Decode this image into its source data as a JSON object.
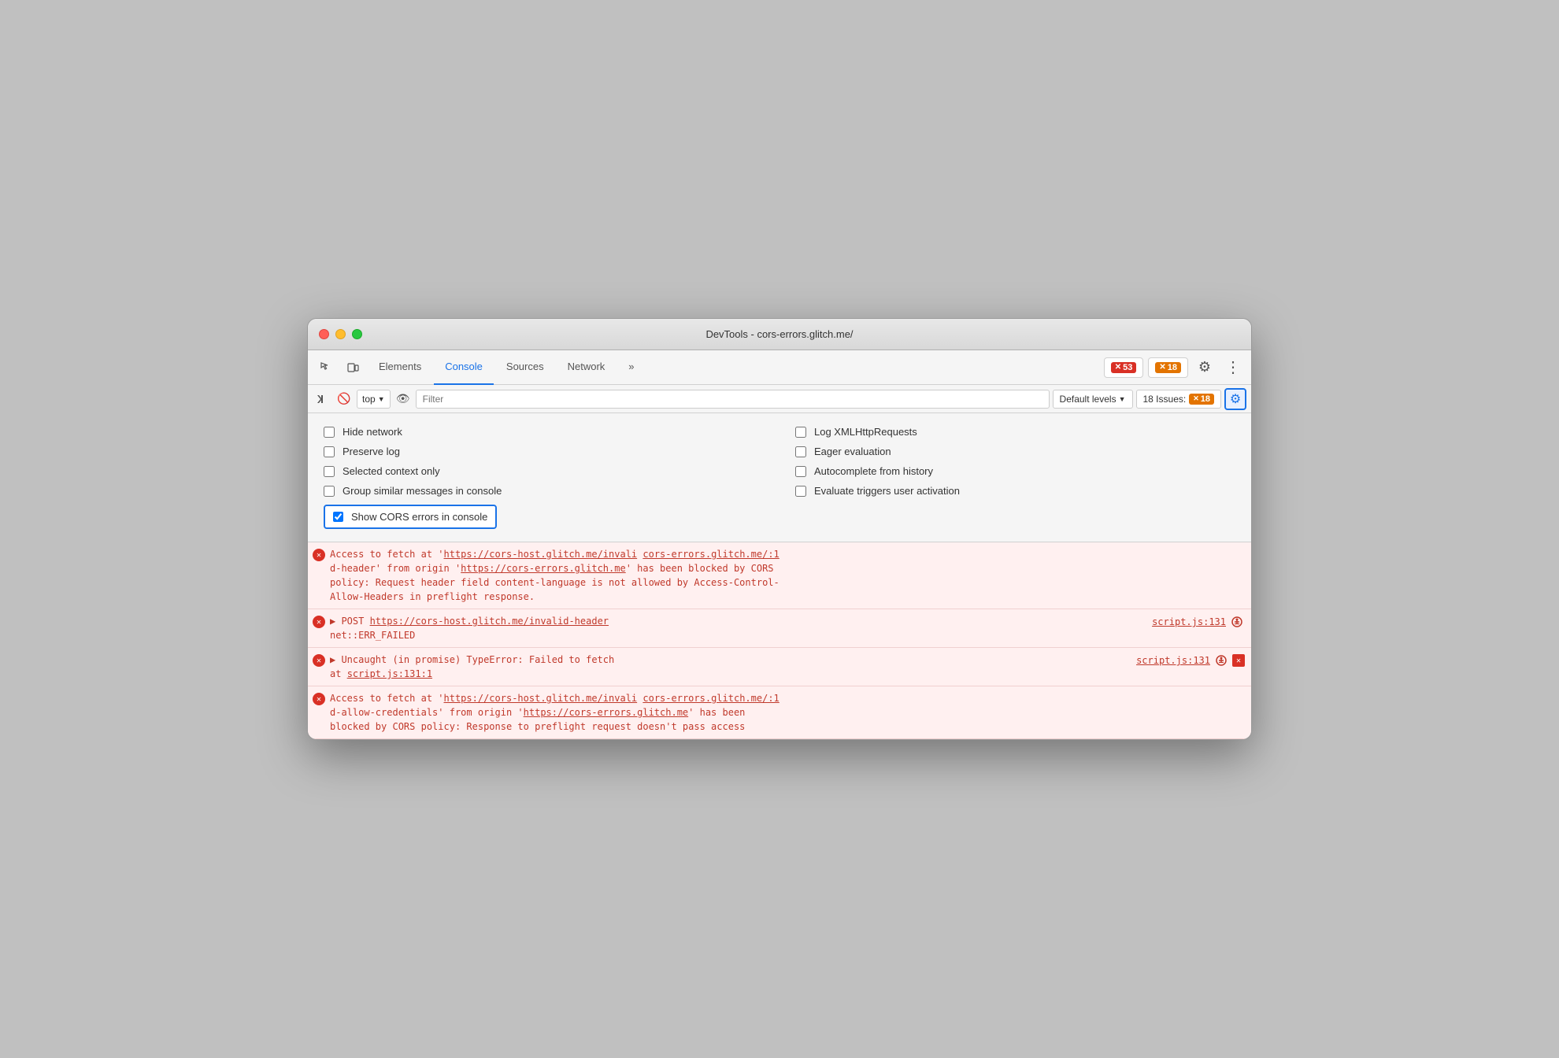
{
  "window": {
    "title": "DevTools - cors-errors.glitch.me/"
  },
  "toolbar": {
    "tabs": [
      {
        "label": "Elements",
        "active": false
      },
      {
        "label": "Console",
        "active": true
      },
      {
        "label": "Sources",
        "active": false
      },
      {
        "label": "Network",
        "active": false
      },
      {
        "label": "»",
        "active": false
      }
    ],
    "error_count": "53",
    "warning_count": "18",
    "gear_label": "⚙",
    "more_label": "⋮"
  },
  "console_toolbar": {
    "context": "top",
    "filter_placeholder": "Filter",
    "levels_label": "Default levels",
    "issues_label": "18 Issues:",
    "issues_count": "18"
  },
  "settings": {
    "checkboxes": [
      {
        "id": "hide-network",
        "label": "Hide network",
        "checked": false
      },
      {
        "id": "log-xhr",
        "label": "Log XMLHttpRequests",
        "checked": false
      },
      {
        "id": "preserve-log",
        "label": "Preserve log",
        "checked": false
      },
      {
        "id": "eager-eval",
        "label": "Eager evaluation",
        "checked": false
      },
      {
        "id": "selected-context",
        "label": "Selected context only",
        "checked": false
      },
      {
        "id": "autocomplete",
        "label": "Autocomplete from history",
        "checked": false
      },
      {
        "id": "group-similar",
        "label": "Group similar messages in console",
        "checked": false
      },
      {
        "id": "evaluate-triggers",
        "label": "Evaluate triggers user activation",
        "checked": false
      }
    ],
    "show_cors": {
      "id": "show-cors",
      "label": "Show CORS errors in console",
      "checked": true
    }
  },
  "console_errors": [
    {
      "id": "err1",
      "text": "Access to fetch at 'https://cors-host.glitch.me/invali  cors-errors.glitch.me/:1\nd-header' from origin 'https://cors-errors.glitch.me' has been blocked by CORS\npolicy: Request header field content-language is not allowed by Access-Control-\nAllow-Headers in preflight response.",
      "line1": "Access to fetch at '",
      "link1": "https://cors-host.glitch.me/invali",
      "link1_text": "https://cors-host.glitch.me/invali",
      "link2": "cors-errors.glitch.me/:1",
      "link2_text": "cors-errors.glitch.me/:1",
      "rest": "d-header' from origin '",
      "link3": "https://cors-errors.glitch.me",
      "link3_text": "https://cors-errors.glitch.me",
      "rest2": "' has been blocked by CORS",
      "line3": "policy: Request header field content-language is not allowed by Access-Control-",
      "line4": "Allow-Headers in preflight response.",
      "has_source": false
    },
    {
      "id": "err2",
      "type": "post",
      "prefix": "▶ POST ",
      "link": "https://cors-host.glitch.me/invalid-header",
      "link_text": "https://cors-host.glitch.me/invalid-header",
      "subtext": "net::ERR_FAILED",
      "source": "script.js:131",
      "has_actions": true,
      "action1": "↕",
      "action2": ""
    },
    {
      "id": "err3",
      "type": "promise",
      "text": "▶ Uncaught (in promise) TypeError: Failed to fetch",
      "line2": "    at ",
      "link": "script.js:131:1",
      "link_text": "script.js:131:1",
      "source": "script.js:131",
      "has_actions": true,
      "action1": "↕",
      "action2": "✕",
      "has_close": true
    },
    {
      "id": "err4",
      "text": "Access to fetch at 'https://cors-host.glitch.me/invali  cors-errors.glitch.me/:1\nd-allow-credentials' from origin 'https://cors-errors.glitch.me' has been\nblocked by CORS policy: Response to preflight request doesn't pass access",
      "link1_text": "https://cors-host.glitch.me/invali",
      "link2_text": "cors-errors.glitch.me/:1",
      "link3_text": "https://cors-errors.glitch.me",
      "has_source": false
    }
  ]
}
